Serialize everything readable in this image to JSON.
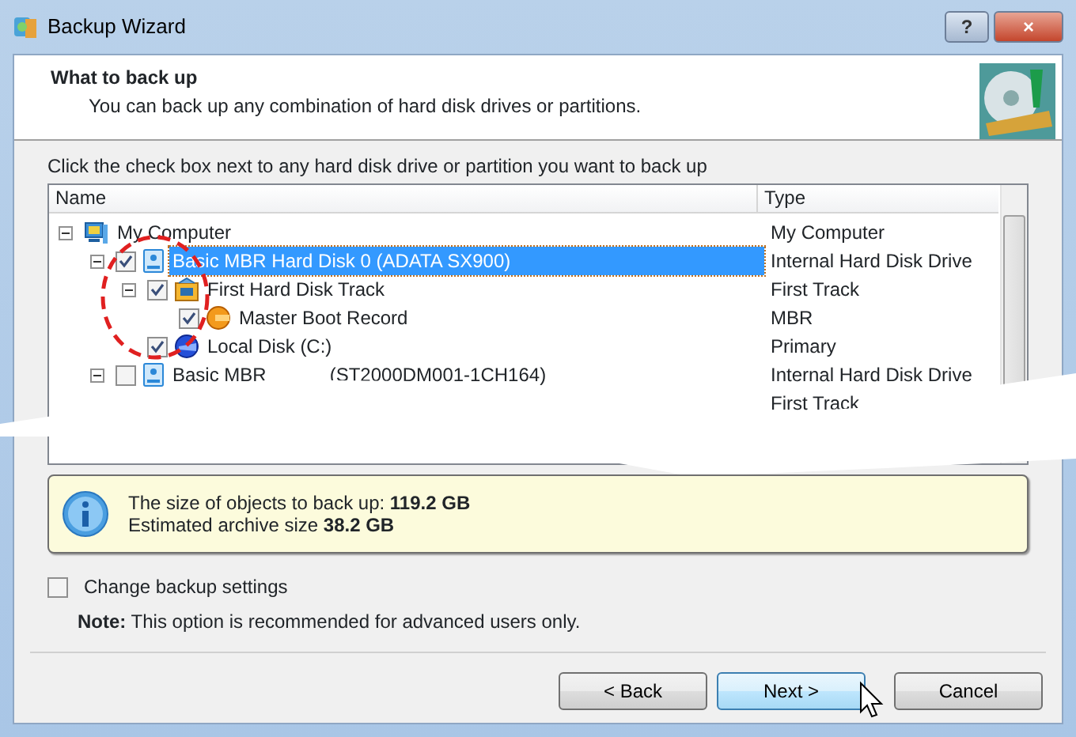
{
  "window": {
    "title": "Backup Wizard",
    "buttons": [
      "?",
      "×"
    ]
  },
  "header": {
    "title": "What to back up",
    "subtitle": "You can back up any combination of hard disk drives or partitions."
  },
  "instruction": "Click the check box next to any hard disk drive or partition you want to back up",
  "tree": {
    "columns": [
      "Name",
      "Type"
    ],
    "items": [
      {
        "name": "My Computer",
        "type": "My Computer",
        "kind": "computer",
        "expanded": true,
        "selected": false,
        "children": [
          {
            "name": "Basic MBR Hard Disk 0 (ADATA SX900)",
            "type": "Internal Hard Disk Drive",
            "kind": "disk",
            "checked": true,
            "expanded": true,
            "selected": true,
            "children": [
              {
                "name": "First Hard Disk Track",
                "type": "First Track",
                "kind": "track",
                "checked": true,
                "expanded": true,
                "selected": false,
                "children": [
                  {
                    "name": "Master Boot Record",
                    "type": "MBR",
                    "kind": "mbr",
                    "checked": true,
                    "selected": false
                  }
                ]
              },
              {
                "name": "Local Disk (C:)",
                "type": "Primary",
                "kind": "volume",
                "checked": true,
                "selected": false
              }
            ]
          },
          {
            "name": "Basic MBR",
            "name_tail": "(ST2000DM001-1CH164)",
            "type": "Internal Hard Disk Drive",
            "kind": "disk",
            "checked": false,
            "expanded": true,
            "selected": false,
            "children": [
              {
                "type": "First Track"
              }
            ]
          }
        ]
      }
    ]
  },
  "info": {
    "lines": [
      "The size of objects to back up: **119.2 GB**",
      "Estimated archive size **38.2 GB**"
    ]
  },
  "option": {
    "label": "Change backup settings",
    "checked": false,
    "note": "**Note:** This option is recommended for advanced users only."
  },
  "buttons": [
    {
      "label": "< Back",
      "selected": false
    },
    {
      "label": "Next >",
      "selected": true
    },
    {
      "label": "Cancel",
      "selected": false
    }
  ]
}
